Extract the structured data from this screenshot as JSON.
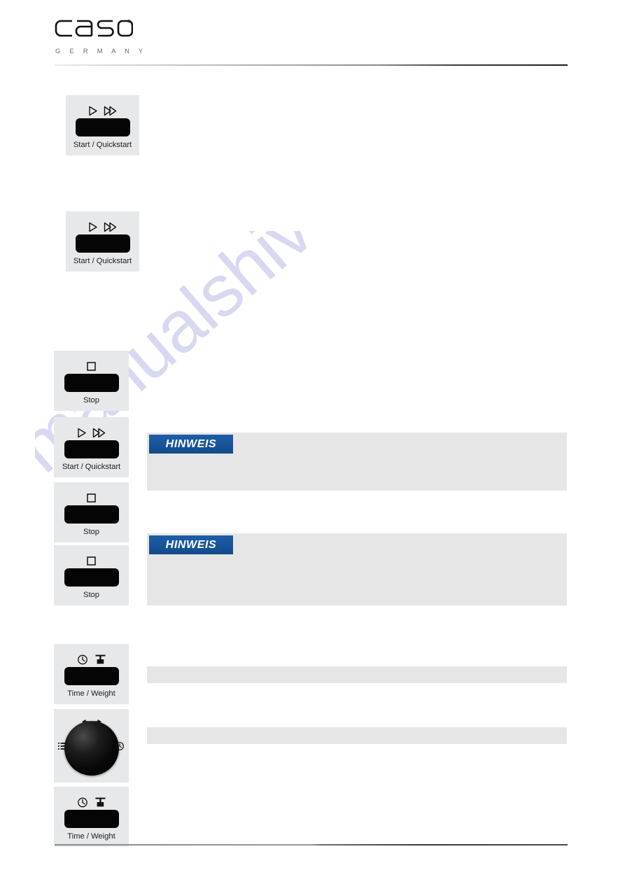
{
  "header": {
    "brand_name": "caso",
    "brand_subtitle": "G E R M A N Y",
    "registered_mark": "®"
  },
  "watermark": {
    "text": "manualshive.com",
    "color": "#b9b9e8"
  },
  "colors": {
    "tile_background": "#e7e8e9",
    "key_black": "#050505",
    "note_badge_blue": "#15539b",
    "note_box_gray": "#e6e6e6",
    "rule_dark": "#1d1d1d"
  },
  "controls": [
    {
      "id": "start-quickstart-1",
      "label": "Start / Quickstart",
      "icons": [
        "play-icon",
        "fast-forward-icon"
      ]
    },
    {
      "id": "start-quickstart-2",
      "label": "Start / Quickstart",
      "icons": [
        "play-icon",
        "fast-forward-icon"
      ]
    },
    {
      "id": "stop-1",
      "label": "Stop",
      "icons": [
        "square-stop-icon"
      ]
    },
    {
      "id": "start-quickstart-3",
      "label": "Start / Quickstart",
      "icons": [
        "play-icon",
        "fast-forward-icon"
      ]
    },
    {
      "id": "stop-2",
      "label": "Stop",
      "icons": [
        "square-stop-icon"
      ]
    },
    {
      "id": "stop-3",
      "label": "Stop",
      "icons": [
        "square-stop-icon"
      ]
    },
    {
      "id": "time-weight-1",
      "label": "Time / Weight",
      "icons": [
        "clock-icon",
        "weight-scale-icon"
      ]
    },
    {
      "id": "rotary-knob",
      "label": "",
      "icons": [
        "left-right-arrow-icon",
        "menu-lines-icon",
        "clock-icon"
      ]
    },
    {
      "id": "time-weight-2",
      "label": "Time / Weight",
      "icons": [
        "clock-icon",
        "weight-scale-icon"
      ]
    }
  ],
  "notes": [
    {
      "id": "note-1",
      "badge": "HINWEIS",
      "body": ""
    },
    {
      "id": "note-2",
      "badge": "HINWEIS",
      "body": ""
    }
  ],
  "table_rows": [
    {
      "id": "row-1",
      "text": ""
    },
    {
      "id": "row-2",
      "text": ""
    }
  ]
}
